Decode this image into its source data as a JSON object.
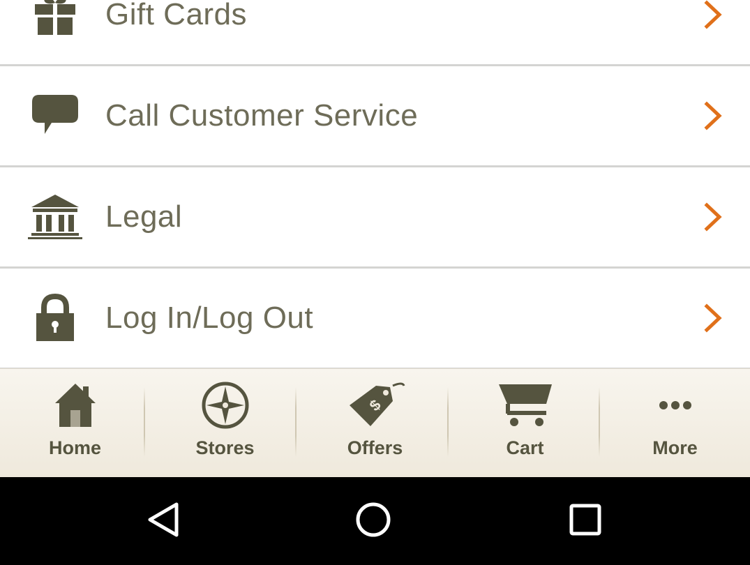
{
  "menu": {
    "items": [
      {
        "label": "Gift Cards",
        "icon": "gift-icon"
      },
      {
        "label": "Call Customer Service",
        "icon": "speech-bubble-icon"
      },
      {
        "label": "Legal",
        "icon": "courthouse-icon"
      },
      {
        "label": "Log In/Log Out",
        "icon": "lock-icon"
      }
    ],
    "chevron_icon": "chevron-right-icon",
    "text_color": "#6e6c58",
    "icon_color": "#55543f",
    "accent_color": "#e0701a"
  },
  "tab_bar": {
    "tabs": [
      {
        "label": "Home",
        "icon": "house-icon"
      },
      {
        "label": "Stores",
        "icon": "compass-icon"
      },
      {
        "label": "Offers",
        "icon": "price-tag-icon"
      },
      {
        "label": "Cart",
        "icon": "cart-icon"
      },
      {
        "label": "More",
        "icon": "more-dots-icon"
      }
    ]
  },
  "nav_bar": {
    "buttons": [
      {
        "name": "back",
        "icon": "back-triangle-icon"
      },
      {
        "name": "home",
        "icon": "home-circle-icon"
      },
      {
        "name": "recents",
        "icon": "recents-square-icon"
      }
    ]
  }
}
